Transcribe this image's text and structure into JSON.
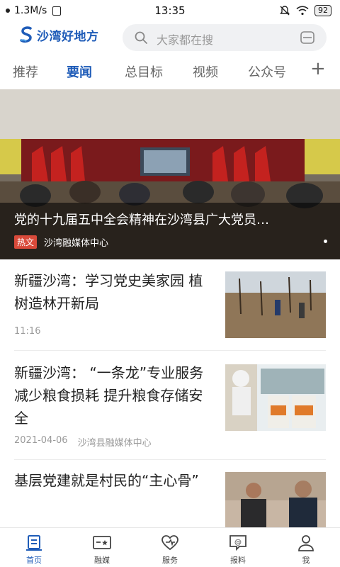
{
  "status": {
    "speed": "1.3M/s",
    "time": "13:35",
    "battery": "92"
  },
  "header": {
    "brand": "沙湾好地方",
    "search_placeholder": "大家都在搜"
  },
  "tabs": [
    "推荐",
    "要闻",
    "总目标",
    "视频",
    "公众号"
  ],
  "active_tab": 1,
  "hero": {
    "title": "党的十九届五中全会精神在沙湾县广大党员…",
    "badge": "热文",
    "source": "沙湾融媒体中心"
  },
  "news": [
    {
      "title": "新疆沙湾：学习党史美家园 植树造林开新局",
      "time": "11:16",
      "source": ""
    },
    {
      "title": "新疆沙湾：  “一条龙”专业服务 减少粮食损耗 提升粮食存储安全",
      "time": "2021-04-06",
      "source": "沙湾县融媒体中心"
    },
    {
      "title": "基层党建就是村民的“主心骨”",
      "time": "",
      "source": ""
    }
  ],
  "bottom_nav": [
    {
      "label": "首页",
      "icon": "home-icon"
    },
    {
      "label": "融媒",
      "icon": "media-icon"
    },
    {
      "label": "服务",
      "icon": "service-heart-icon"
    },
    {
      "label": "报料",
      "icon": "report-icon"
    },
    {
      "label": "我",
      "icon": "profile-icon"
    }
  ],
  "colors": {
    "accent": "#1f5cb8",
    "hot_badge": "#d94a3a",
    "inactive_text": "#666666"
  }
}
